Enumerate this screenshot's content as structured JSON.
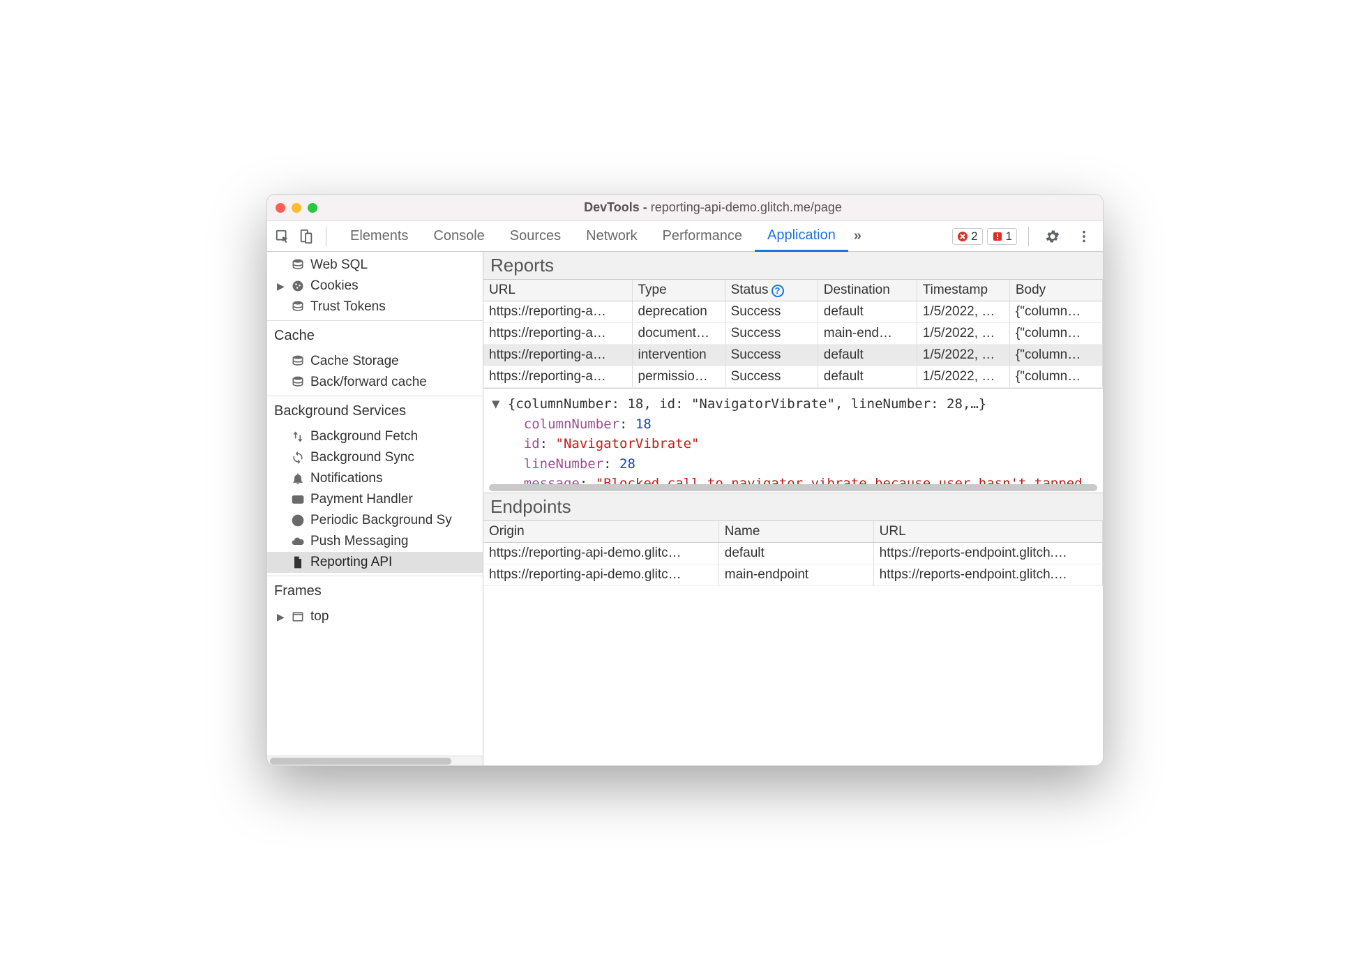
{
  "window": {
    "app": "DevTools",
    "page": "reporting-api-demo.glitch.me/page"
  },
  "toolbar": {
    "tabs": [
      "Elements",
      "Console",
      "Sources",
      "Network",
      "Performance",
      "Application"
    ],
    "active_tab": "Application",
    "error_count": "2",
    "issue_count": "1"
  },
  "sidebar": {
    "storage": [
      {
        "label": "Web SQL",
        "icon": "db"
      },
      {
        "label": "Cookies",
        "icon": "cookie",
        "expandable": true
      },
      {
        "label": "Trust Tokens",
        "icon": "db"
      }
    ],
    "cache_heading": "Cache",
    "cache": [
      {
        "label": "Cache Storage",
        "icon": "db"
      },
      {
        "label": "Back/forward cache",
        "icon": "db"
      }
    ],
    "bg_heading": "Background Services",
    "bg": [
      {
        "label": "Background Fetch",
        "icon": "updown"
      },
      {
        "label": "Background Sync",
        "icon": "sync"
      },
      {
        "label": "Notifications",
        "icon": "bell"
      },
      {
        "label": "Payment Handler",
        "icon": "card"
      },
      {
        "label": "Periodic Background Sy",
        "icon": "clock"
      },
      {
        "label": "Push Messaging",
        "icon": "cloud"
      },
      {
        "label": "Reporting API",
        "icon": "doc",
        "selected": true
      }
    ],
    "frames_heading": "Frames",
    "frames": [
      {
        "label": "top",
        "icon": "frame",
        "expandable": true
      }
    ]
  },
  "reports": {
    "heading": "Reports",
    "columns": [
      "URL",
      "Type",
      "Status",
      "Destination",
      "Timestamp",
      "Body"
    ],
    "rows": [
      {
        "url": "https://reporting-a…",
        "type": "deprecation",
        "status": "Success",
        "dest": "default",
        "ts": "1/5/2022, …",
        "body": "{\"column…",
        "selected": false
      },
      {
        "url": "https://reporting-a…",
        "type": "document…",
        "status": "Success",
        "dest": "main-end…",
        "ts": "1/5/2022, …",
        "body": "{\"column…",
        "selected": false
      },
      {
        "url": "https://reporting-a…",
        "type": "intervention",
        "status": "Success",
        "dest": "default",
        "ts": "1/5/2022, …",
        "body": "{\"column…",
        "selected": true
      },
      {
        "url": "https://reporting-a…",
        "type": "permissio…",
        "status": "Success",
        "dest": "default",
        "ts": "1/5/2022, …",
        "body": "{\"column…",
        "selected": false
      }
    ]
  },
  "object_preview": {
    "summary": "{columnNumber: 18, id: \"NavigatorVibrate\", lineNumber: 28,…}",
    "fields": {
      "columnNumber": "18",
      "id": "\"NavigatorVibrate\"",
      "lineNumber": "28",
      "message": "\"Blocked call to navigator.vibrate because user hasn't tapped"
    }
  },
  "endpoints": {
    "heading": "Endpoints",
    "columns": [
      "Origin",
      "Name",
      "URL"
    ],
    "rows": [
      {
        "origin": "https://reporting-api-demo.glitc…",
        "name": "default",
        "url": "https://reports-endpoint.glitch.…"
      },
      {
        "origin": "https://reporting-api-demo.glitc…",
        "name": "main-endpoint",
        "url": "https://reports-endpoint.glitch.…"
      }
    ]
  }
}
